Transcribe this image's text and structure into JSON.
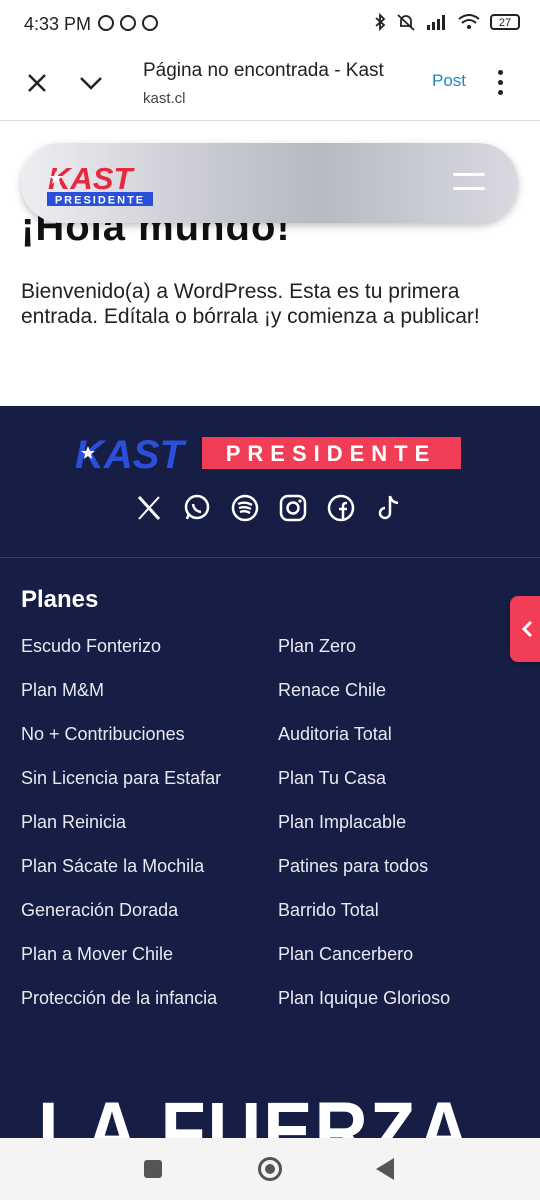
{
  "status": {
    "time": "4:33 PM",
    "battery": "27"
  },
  "browser": {
    "title": "Página no encontrada - Kast",
    "url": "kast.cl",
    "post_label": "Post"
  },
  "header": {
    "logo_top": "KAST",
    "logo_bottom": "PRESIDENTE"
  },
  "post": {
    "title": "¡Hola mundo!",
    "body": "Bienvenido(a) a WordPress. Esta es tu primera entrada. Edítala o bórrala ¡y comienza a publicar!"
  },
  "footer": {
    "logo_left": "KAST",
    "logo_right": "PRESIDENTE",
    "social_icons": [
      "x-icon",
      "whatsapp-icon",
      "spotify-icon",
      "instagram-icon",
      "facebook-icon",
      "tiktok-icon"
    ],
    "planes_title": "Planes",
    "plans_left": [
      "Escudo Fonterizo",
      "Plan M&M",
      "No + Contribuciones",
      "Sin Licencia para Estafar",
      "Plan Reinicia",
      "Plan Sácate la Mochila",
      "Generación Dorada",
      "Plan a Mover Chile",
      "Protección de la infancia"
    ],
    "plans_right": [
      "Plan Zero",
      "Renace Chile",
      "Auditoria Total",
      "Plan Tu Casa",
      "Plan Implacable",
      "Patines para todos",
      "Barrido Total",
      "Plan Cancerbero",
      "Plan Iquique Glorioso"
    ],
    "banner_text": "LA FUERZA"
  },
  "colors": {
    "footer_bg": "#171e45",
    "brand_red": "#f23d56",
    "brand_blue": "#2a4fd8",
    "link_blue": "#1e88c9"
  }
}
